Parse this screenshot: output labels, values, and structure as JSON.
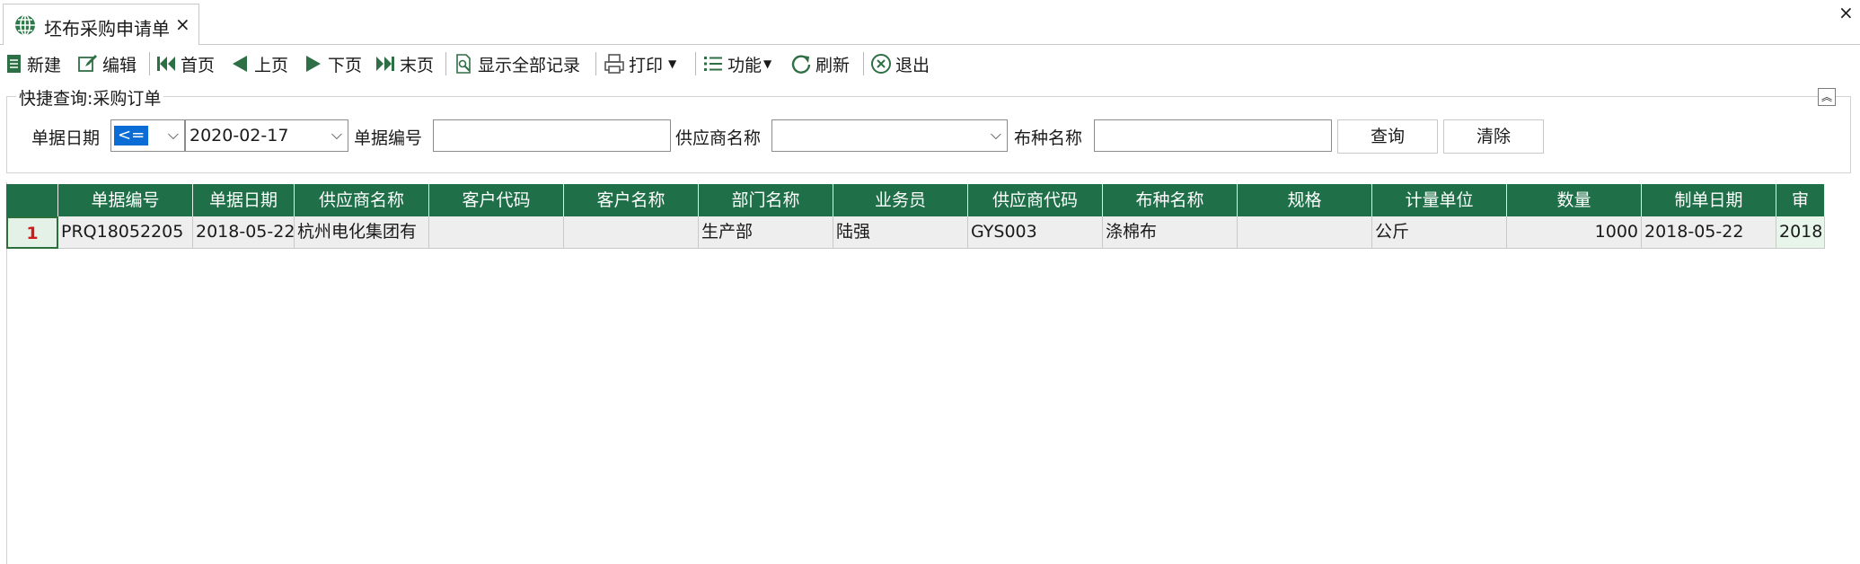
{
  "tab": {
    "title": "坯布采购申请单",
    "close": "×"
  },
  "window": {
    "close": "×"
  },
  "toolbar": {
    "new": "新建",
    "edit": "编辑",
    "first": "首页",
    "prev": "上页",
    "next": "下页",
    "last": "末页",
    "show_all": "显示全部记录",
    "print": "打印",
    "functions": "功能",
    "refresh": "刷新",
    "exit": "退出"
  },
  "query": {
    "legend": "快捷查询:采购订单",
    "date_label": "单据日期",
    "operator": "<=",
    "date_value": "2020-02-17",
    "doc_no_label": "单据编号",
    "doc_no_value": "",
    "supplier_label": "供应商名称",
    "supplier_value": "",
    "fabric_label": "布种名称",
    "fabric_value": "",
    "search_button": "查询",
    "clear_button": "清除"
  },
  "grid": {
    "columns": [
      "单据编号",
      "单据日期",
      "供应商名称",
      "客户代码",
      "客户名称",
      "部门名称",
      "业务员",
      "供应商代码",
      "布种名称",
      "规格",
      "计量单位",
      "数量",
      "制单日期",
      "审"
    ],
    "rows": [
      {
        "row_no": "1",
        "cells": [
          "PRQ18052205",
          "2018-05-22",
          "杭州电化集团有",
          "",
          "",
          "生产部",
          "陆强",
          "GYS003",
          "涤棉布",
          "",
          "公斤",
          "1000",
          "2018-05-22",
          "2018"
        ]
      }
    ]
  }
}
